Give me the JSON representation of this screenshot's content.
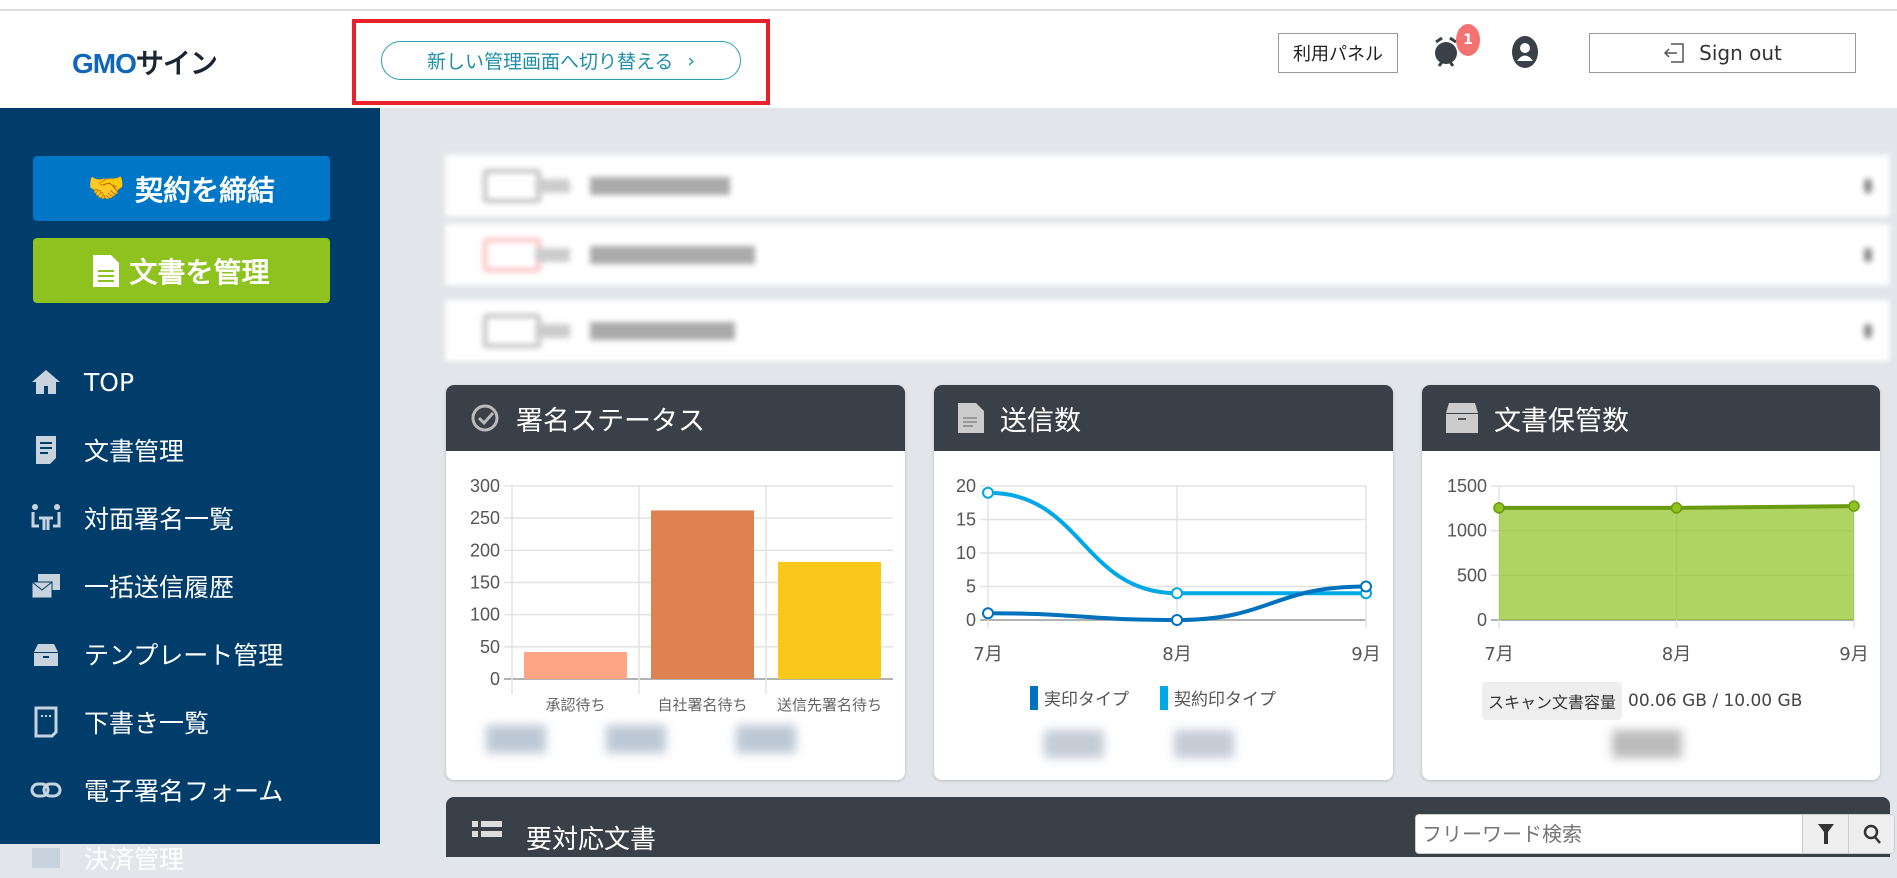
{
  "header": {
    "logo": "GMOサイン",
    "logo_parts": [
      "GMO",
      "サイン"
    ],
    "switch_label": "新しい管理画面へ切り替える",
    "switch_chevron": "›",
    "panel_label": "利用パネル",
    "notification_count": "1",
    "signout_label": "Sign out",
    "highlight_color": "#e8202a"
  },
  "sidebar": {
    "contract_button": "契約を締結",
    "manage_button": "文書を管理",
    "items": [
      {
        "label": "TOP",
        "icon": "home-icon"
      },
      {
        "label": "文書管理",
        "icon": "document-list-icon"
      },
      {
        "label": "対面署名一覧",
        "icon": "face-to-face-icon"
      },
      {
        "label": "一括送信履歴",
        "icon": "bulk-send-icon"
      },
      {
        "label": "テンプレート管理",
        "icon": "archive-box-icon"
      },
      {
        "label": "下書き一覧",
        "icon": "draft-icon"
      },
      {
        "label": "電子署名フォーム",
        "icon": "link-icon"
      },
      {
        "label": "決済管理",
        "icon": "payment-icon"
      }
    ]
  },
  "cards": {
    "status": {
      "title": "署名ステータス"
    },
    "sent": {
      "title": "送信数"
    },
    "storage": {
      "title": "文書保管数",
      "scan_label": "スキャン文書容量",
      "scan_value": "00.06 GB / 10.00 GB"
    }
  },
  "bottom": {
    "title": "要対応文書",
    "search_placeholder": "フリーワード検索"
  },
  "chart_data": [
    {
      "type": "bar",
      "categories": [
        "承認待ち",
        "自社署名待ち",
        "送信先署名待ち"
      ],
      "values": [
        42,
        262,
        182
      ],
      "colors": [
        "#ffa584",
        "#df8252",
        "#f9c81b"
      ],
      "ylim": [
        0,
        300
      ],
      "yticks": [
        0,
        50,
        100,
        150,
        200,
        250,
        300
      ],
      "grid": true
    },
    {
      "type": "line",
      "categories": [
        "7月",
        "8月",
        "9月"
      ],
      "series": [
        {
          "name": "実印タイプ",
          "values": [
            1,
            0,
            5
          ],
          "color": "#0071bc"
        },
        {
          "name": "契約印タイプ",
          "values": [
            19,
            4,
            4
          ],
          "color": "#00a9e6"
        }
      ],
      "ylim": [
        0,
        20
      ],
      "yticks": [
        0,
        5,
        10,
        15,
        20
      ],
      "grid": true,
      "legend": "bottom"
    },
    {
      "type": "area",
      "categories": [
        "7月",
        "8月",
        "9月"
      ],
      "values": [
        1255,
        1255,
        1275
      ],
      "color": "#8dc21f",
      "ylim": [
        0,
        1500
      ],
      "yticks": [
        0,
        500,
        1000,
        1500
      ],
      "grid": true
    }
  ]
}
